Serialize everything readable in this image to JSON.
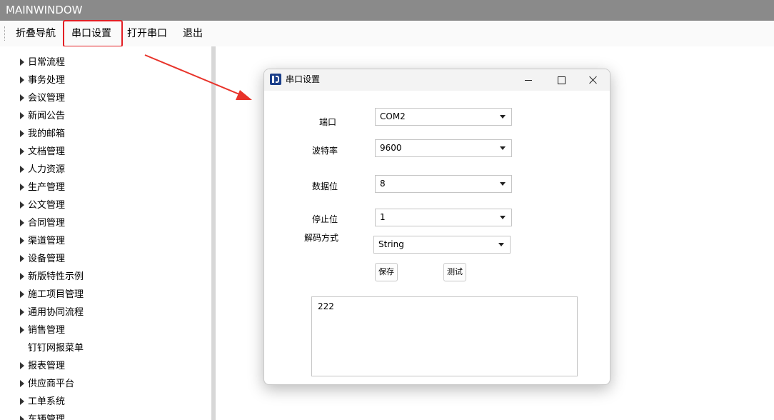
{
  "window": {
    "title": "MAINWINDOW"
  },
  "menu": {
    "items": [
      {
        "label": "折叠导航"
      },
      {
        "label": "串口设置"
      },
      {
        "label": "打开串口"
      },
      {
        "label": "退出"
      }
    ]
  },
  "tree": {
    "items": [
      {
        "label": "日常流程",
        "has_children": true
      },
      {
        "label": "事务处理",
        "has_children": true
      },
      {
        "label": "会议管理",
        "has_children": true
      },
      {
        "label": "新闻公告",
        "has_children": true
      },
      {
        "label": "我的邮箱",
        "has_children": true
      },
      {
        "label": "文档管理",
        "has_children": true
      },
      {
        "label": "人力资源",
        "has_children": true
      },
      {
        "label": "生产管理",
        "has_children": true
      },
      {
        "label": "公文管理",
        "has_children": true
      },
      {
        "label": "合同管理",
        "has_children": true
      },
      {
        "label": "渠道管理",
        "has_children": true
      },
      {
        "label": "设备管理",
        "has_children": true
      },
      {
        "label": "新版特性示例",
        "has_children": true
      },
      {
        "label": "施工项目管理",
        "has_children": true
      },
      {
        "label": "通用协同流程",
        "has_children": true
      },
      {
        "label": "销售管理",
        "has_children": true
      },
      {
        "label": "钉钉网报菜单",
        "has_children": false
      },
      {
        "label": "报表管理",
        "has_children": true
      },
      {
        "label": "供应商平台",
        "has_children": true
      },
      {
        "label": "工单系统",
        "has_children": true
      },
      {
        "label": "车辆管理",
        "has_children": true
      }
    ]
  },
  "dialog": {
    "title": "串口设置",
    "port": {
      "label": "端口",
      "value": "COM2"
    },
    "baud": {
      "label": "波特率",
      "value": "9600"
    },
    "databits": {
      "label": "数据位",
      "value": "8"
    },
    "stopbits": {
      "label": "停止位",
      "value": "1"
    },
    "decode": {
      "label": "解码方式",
      "value": "String"
    },
    "save_label": "保存",
    "test_label": "测试",
    "output_text": "222"
  },
  "colors": {
    "titlebar": "#8a8a8a",
    "highlight": "#e31e24",
    "arrow": "#e8332a",
    "splitter": "#d7d7d7"
  }
}
